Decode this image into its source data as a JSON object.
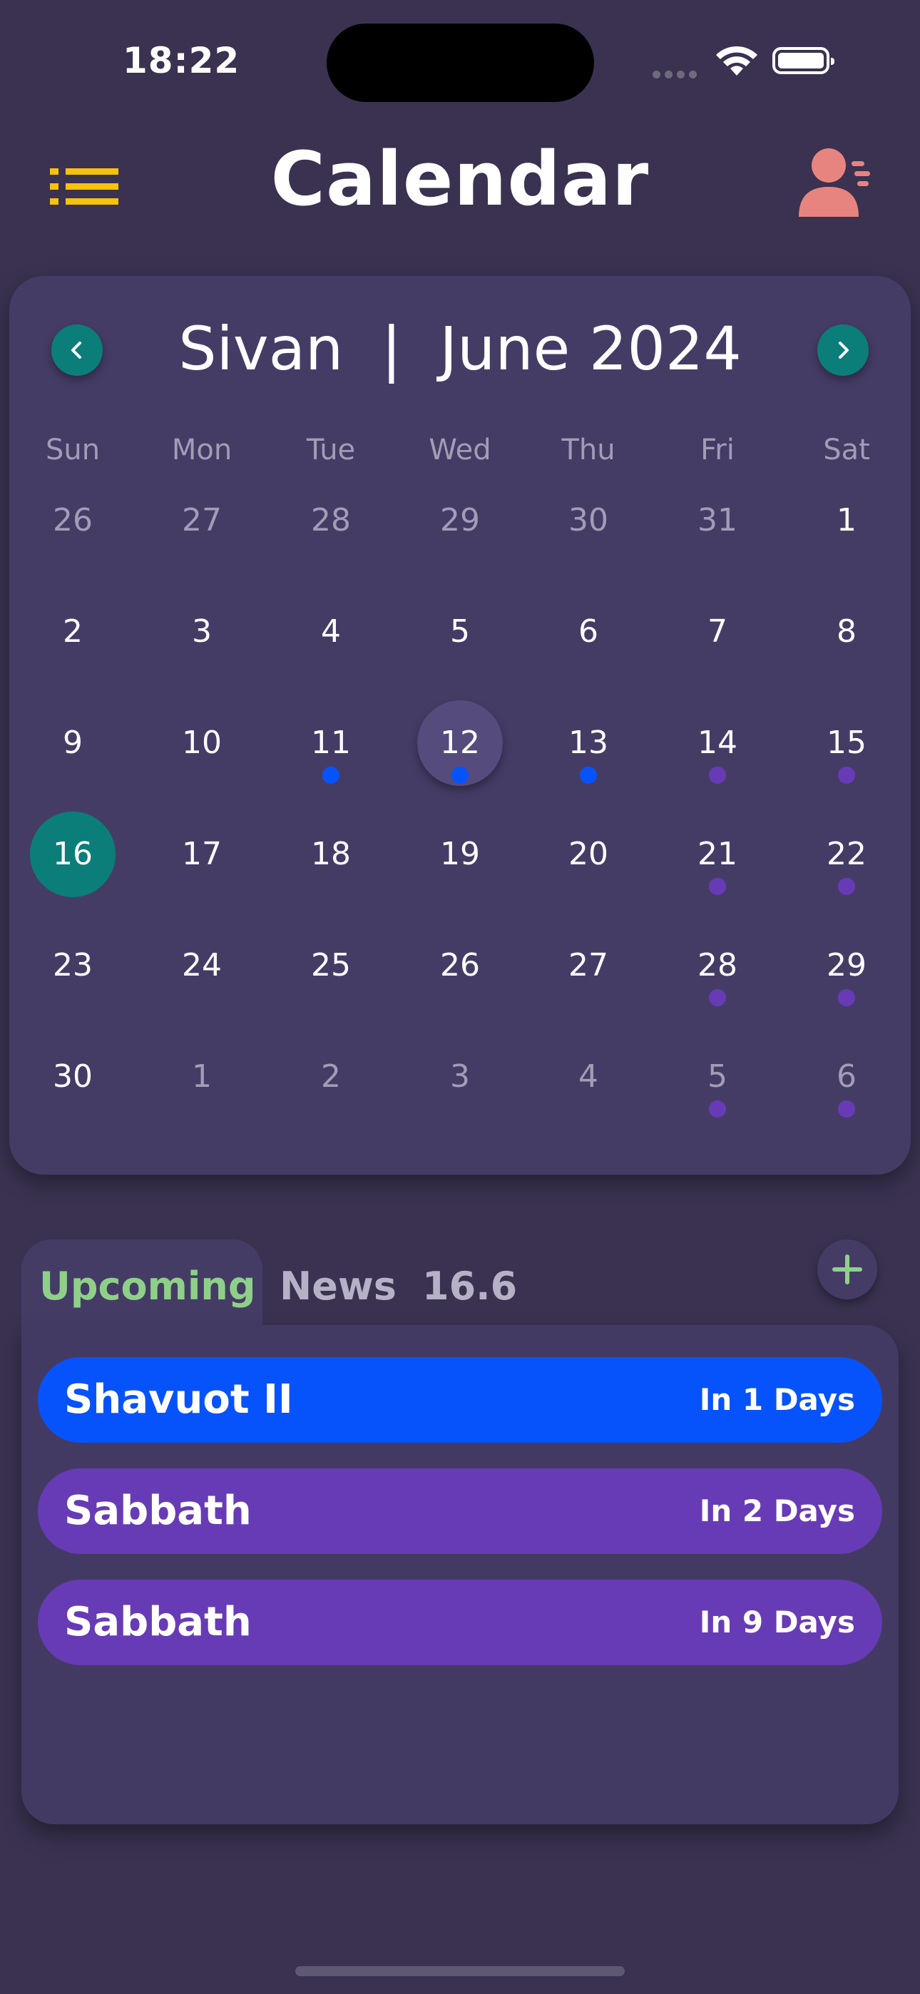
{
  "status_bar": {
    "time": "18:22"
  },
  "header": {
    "title": "Calendar"
  },
  "calendar": {
    "month_title": "Sivan  |  June 2024",
    "weekdays": [
      "Sun",
      "Mon",
      "Tue",
      "Wed",
      "Thu",
      "Fri",
      "Sat"
    ],
    "days": [
      {
        "n": "26",
        "muted": true
      },
      {
        "n": "27",
        "muted": true
      },
      {
        "n": "28",
        "muted": true
      },
      {
        "n": "29",
        "muted": true
      },
      {
        "n": "30",
        "muted": true
      },
      {
        "n": "31",
        "muted": true
      },
      {
        "n": "1"
      },
      {
        "n": "2"
      },
      {
        "n": "3"
      },
      {
        "n": "4"
      },
      {
        "n": "5"
      },
      {
        "n": "6"
      },
      {
        "n": "7"
      },
      {
        "n": "8"
      },
      {
        "n": "9"
      },
      {
        "n": "10"
      },
      {
        "n": "11",
        "dot": "blue"
      },
      {
        "n": "12",
        "dot": "blue",
        "selected": true
      },
      {
        "n": "13",
        "dot": "blue"
      },
      {
        "n": "14",
        "dot": "purple"
      },
      {
        "n": "15",
        "dot": "purple"
      },
      {
        "n": "16",
        "today": true
      },
      {
        "n": "17"
      },
      {
        "n": "18"
      },
      {
        "n": "19"
      },
      {
        "n": "20"
      },
      {
        "n": "21",
        "dot": "purple"
      },
      {
        "n": "22",
        "dot": "purple"
      },
      {
        "n": "23"
      },
      {
        "n": "24"
      },
      {
        "n": "25"
      },
      {
        "n": "26"
      },
      {
        "n": "27"
      },
      {
        "n": "28",
        "dot": "purple"
      },
      {
        "n": "29",
        "dot": "purple"
      },
      {
        "n": "30"
      },
      {
        "n": "1",
        "muted": true
      },
      {
        "n": "2",
        "muted": true
      },
      {
        "n": "3",
        "muted": true
      },
      {
        "n": "4",
        "muted": true
      },
      {
        "n": "5",
        "muted": true,
        "dot": "purple"
      },
      {
        "n": "6",
        "muted": true,
        "dot": "purple"
      }
    ]
  },
  "tabs": {
    "upcoming": "Upcoming",
    "news": "News",
    "date": "16.6"
  },
  "events": [
    {
      "name": "Shavuot II",
      "when": "In 1 Days",
      "color": "#0753fb"
    },
    {
      "name": "Sabbath",
      "when": "In 2 Days",
      "color": "#683bb6"
    },
    {
      "name": "Sabbath",
      "when": "In 9 Days",
      "color": "#683bb6"
    }
  ],
  "colors": {
    "background": "#3a3250",
    "card": "#453c66",
    "accent_teal": "#0b7e7a",
    "selected_circle": "#564b7d",
    "dot_blue": "#0753fb",
    "dot_purple": "#683bb6",
    "tab_active": "#8fd089",
    "menu_yellow": "#f5c20c",
    "profile_pink": "#e8847f"
  },
  "icons": [
    "menu-list-icon",
    "user-profile-icon",
    "chevron-left-icon",
    "chevron-right-icon",
    "plus-icon",
    "wifi-icon",
    "battery-icon"
  ]
}
